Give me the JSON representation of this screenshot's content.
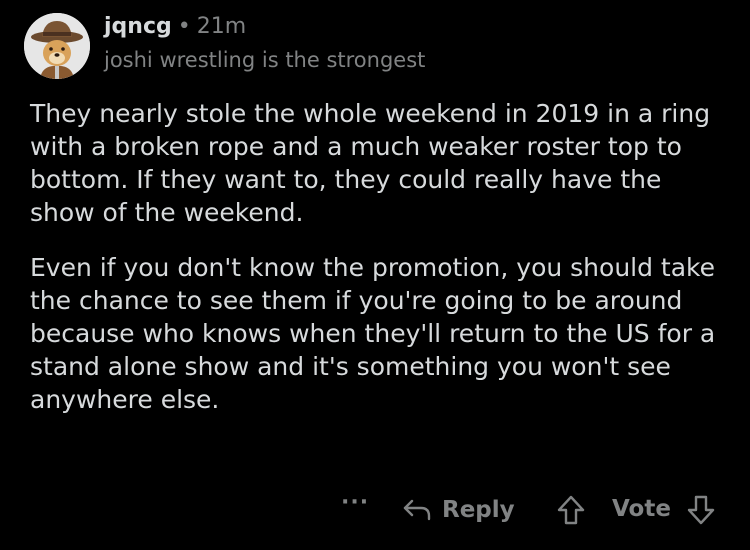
{
  "comment": {
    "username": "jqncg",
    "separator": "•",
    "time": "21m",
    "flair": "joshi wrestling is the strongest",
    "paragraphs": [
      "They nearly stole the whole weekend in 2019 in a ring with a broken rope and a much weaker roster top to bottom. If they want to, they could really have the show of the weekend.",
      "Even if you don't know the promotion, you should take the chance to see them if you're going to be around because who knows when they'll return to the US for a stand alone show and it's something you won't see anywhere else."
    ]
  },
  "actions": {
    "more_label": "···",
    "reply_label": "Reply",
    "vote_label": "Vote",
    "icons": [
      "reply-arrow-icon",
      "upvote-arrow-icon",
      "downvote-arrow-icon",
      "more-icon"
    ]
  },
  "colors": {
    "background": "#000000",
    "text": "#d7dadc",
    "muted": "#818384"
  }
}
